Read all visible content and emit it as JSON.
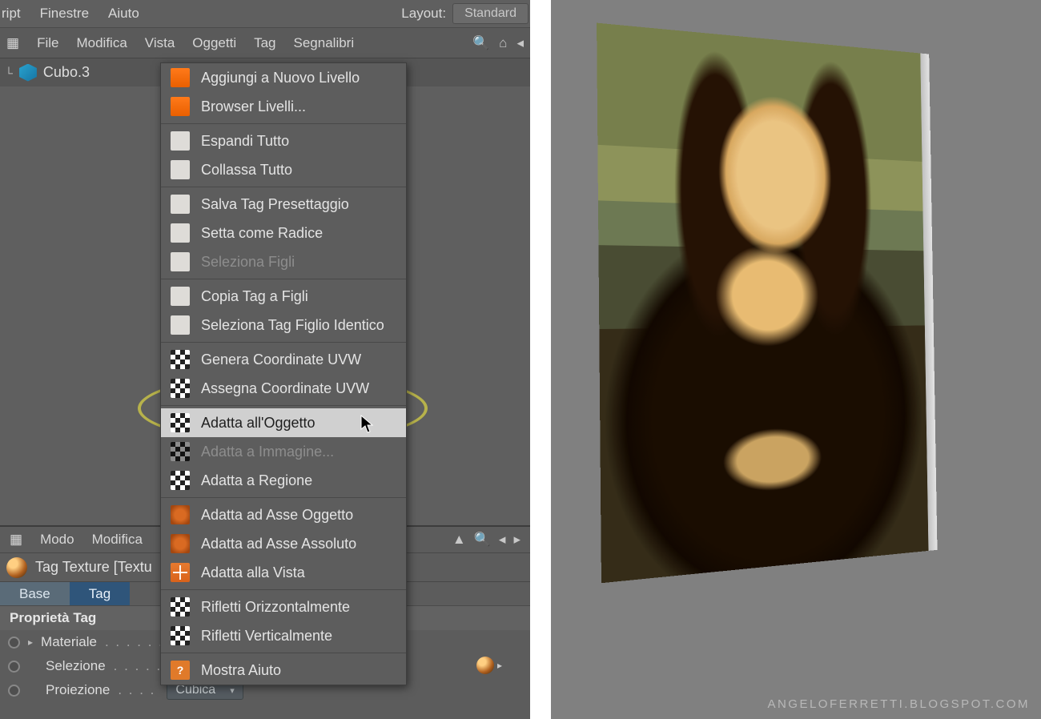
{
  "top_menu": {
    "items": [
      "ript",
      "Finestre",
      "Aiuto"
    ],
    "layout_label": "Layout:",
    "layout_value": "Standard"
  },
  "panel_menu": {
    "items": [
      "File",
      "Modifica",
      "Vista",
      "Oggetti",
      "Tag",
      "Segnalibri"
    ]
  },
  "object": {
    "name": "Cubo.3"
  },
  "context_menu": {
    "groups": [
      [
        {
          "key": "add_layer",
          "label": "Aggiungi a Nuovo Livello",
          "icon": "orange"
        },
        {
          "key": "layer_browser",
          "label": "Browser Livelli...",
          "icon": "orange"
        }
      ],
      [
        {
          "key": "expand_all",
          "label": "Espandi Tutto",
          "icon": "pale"
        },
        {
          "key": "collapse_all",
          "label": "Collassa Tutto",
          "icon": "pale"
        }
      ],
      [
        {
          "key": "save_tag_preset",
          "label": "Salva Tag Presettaggio",
          "icon": "house"
        },
        {
          "key": "set_root",
          "label": "Setta come Radice",
          "icon": "house"
        },
        {
          "key": "select_children",
          "label": "Seleziona Figli",
          "icon": "house",
          "disabled": true
        }
      ],
      [
        {
          "key": "copy_tag_children",
          "label": "Copia Tag a Figli",
          "icon": "pale"
        },
        {
          "key": "select_identical",
          "label": "Seleziona Tag Figlio Identico",
          "icon": "pale"
        }
      ],
      [
        {
          "key": "gen_uvw",
          "label": "Genera Coordinate UVW",
          "icon": "chk"
        },
        {
          "key": "assign_uvw",
          "label": "Assegna Coordinate UVW",
          "icon": "chk"
        }
      ],
      [
        {
          "key": "fit_object",
          "label": "Adatta all'Oggetto",
          "icon": "chk",
          "hover": true
        },
        {
          "key": "fit_image",
          "label": "Adatta a Immagine...",
          "icon": "chk",
          "disabled": true
        },
        {
          "key": "fit_region",
          "label": "Adatta a Regione",
          "icon": "chk"
        }
      ],
      [
        {
          "key": "fit_obj_axis",
          "label": "Adatta ad Asse Oggetto",
          "icon": "globe"
        },
        {
          "key": "fit_abs_axis",
          "label": "Adatta ad Asse Assoluto",
          "icon": "globe"
        },
        {
          "key": "fit_view",
          "label": "Adatta alla Vista",
          "icon": "grid"
        }
      ],
      [
        {
          "key": "mirror_h",
          "label": "Rifletti Orizzontalmente",
          "icon": "chk"
        },
        {
          "key": "mirror_v",
          "label": "Rifletti Verticalmente",
          "icon": "chk"
        }
      ],
      [
        {
          "key": "help",
          "label": "Mostra Aiuto",
          "icon": "help"
        }
      ]
    ]
  },
  "attr": {
    "menu": [
      "Modo",
      "Modifica"
    ],
    "title": "Tag Texture [Textu",
    "tabs": {
      "base": "Base",
      "tag": "Tag"
    },
    "section": "Proprietà Tag",
    "rows": {
      "materiale": "Materiale",
      "selezione": "Selezione",
      "proiezione": "Proiezione",
      "projection_value": "Cubica"
    }
  },
  "watermark": "ANGELOFERRETTI.BLOGSPOT.COM"
}
